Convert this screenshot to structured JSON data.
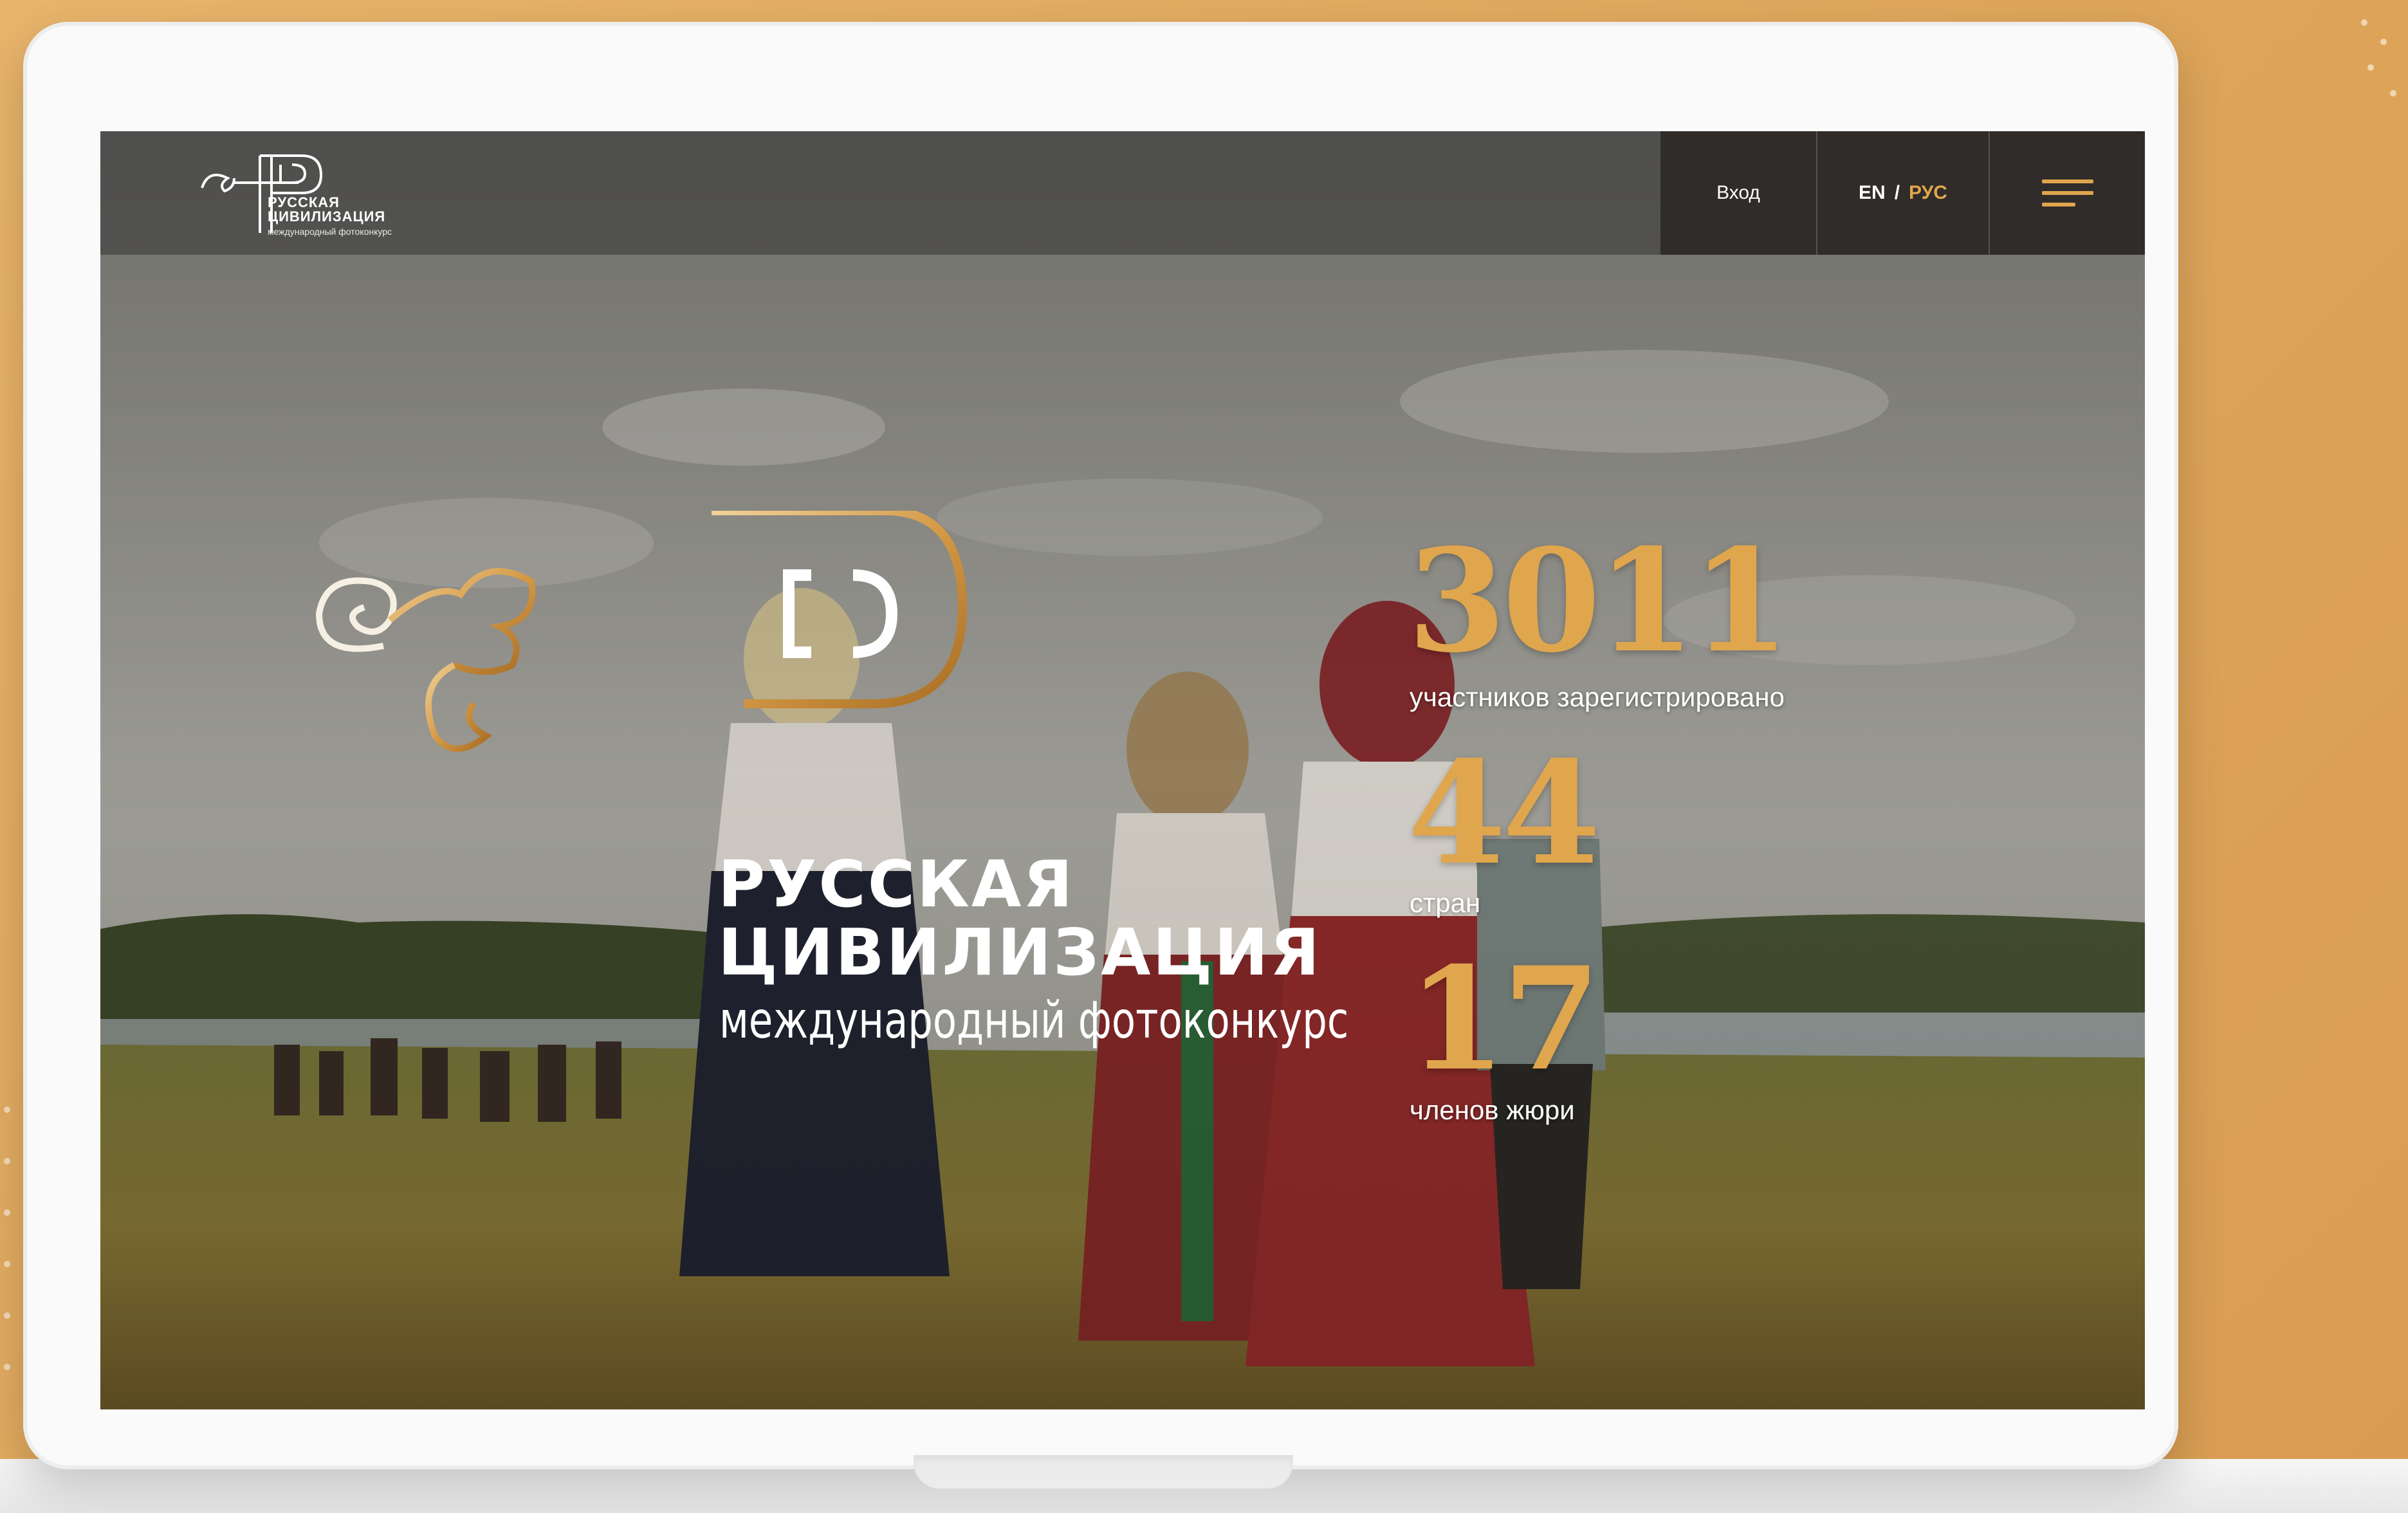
{
  "header": {
    "login_label": "Вход",
    "lang_en": "EN",
    "lang_separator": "/",
    "lang_ru": "РУС",
    "menu_icon": "hamburger-menu-icon",
    "logo_line1": "РУССКАЯ",
    "logo_line2": "ЦИВИЛИЗАЦИЯ",
    "logo_line3": "международный фотоконкурс"
  },
  "hero": {
    "title_line1": "РУССКАЯ",
    "title_line2": "ЦИВИЛИЗАЦИЯ",
    "subtitle": "международный фотоконкурс",
    "logo_icon": "ornamental-r-emblem-icon"
  },
  "stats": [
    {
      "value": "3011",
      "label": "участников зарегистрировано"
    },
    {
      "value": "44",
      "label": "стран"
    },
    {
      "value": "17",
      "label": "членов жюри"
    }
  ],
  "colors": {
    "accent": "#e0a64d",
    "background": "#e3ad63",
    "header_block": "#2d2a28"
  }
}
